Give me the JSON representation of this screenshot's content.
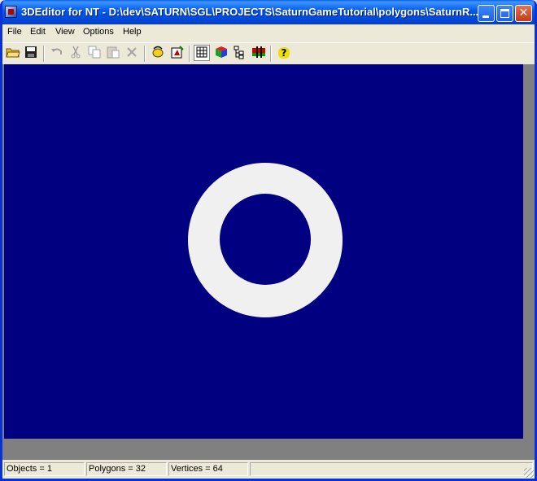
{
  "window": {
    "title": "3DEditor for NT - D:\\dev\\SATURN\\SGL\\PROJECTS\\SaturnGameTutorial\\polygons\\SaturnR..."
  },
  "menu": [
    {
      "label": "File"
    },
    {
      "label": "Edit"
    },
    {
      "label": "View"
    },
    {
      "label": "Options"
    },
    {
      "label": "Help"
    }
  ],
  "toolbar": {
    "icons": [
      "open-folder-icon",
      "save-icon",
      "undo-icon",
      "cut-icon",
      "copy-icon",
      "paste-icon",
      "delete-icon",
      "rotate-icon",
      "render-icon",
      "grid-icon",
      "cube-icon",
      "tree-icon",
      "palette-icon",
      "help-icon"
    ],
    "help_glyph": "?"
  },
  "viewport": {
    "background_color": "#000080",
    "object_color": "#f0f0f0",
    "object": "ring"
  },
  "status": {
    "objects": "Objects = 1",
    "polygons": "Polygons = 32",
    "vertices": "Vertices = 64"
  }
}
